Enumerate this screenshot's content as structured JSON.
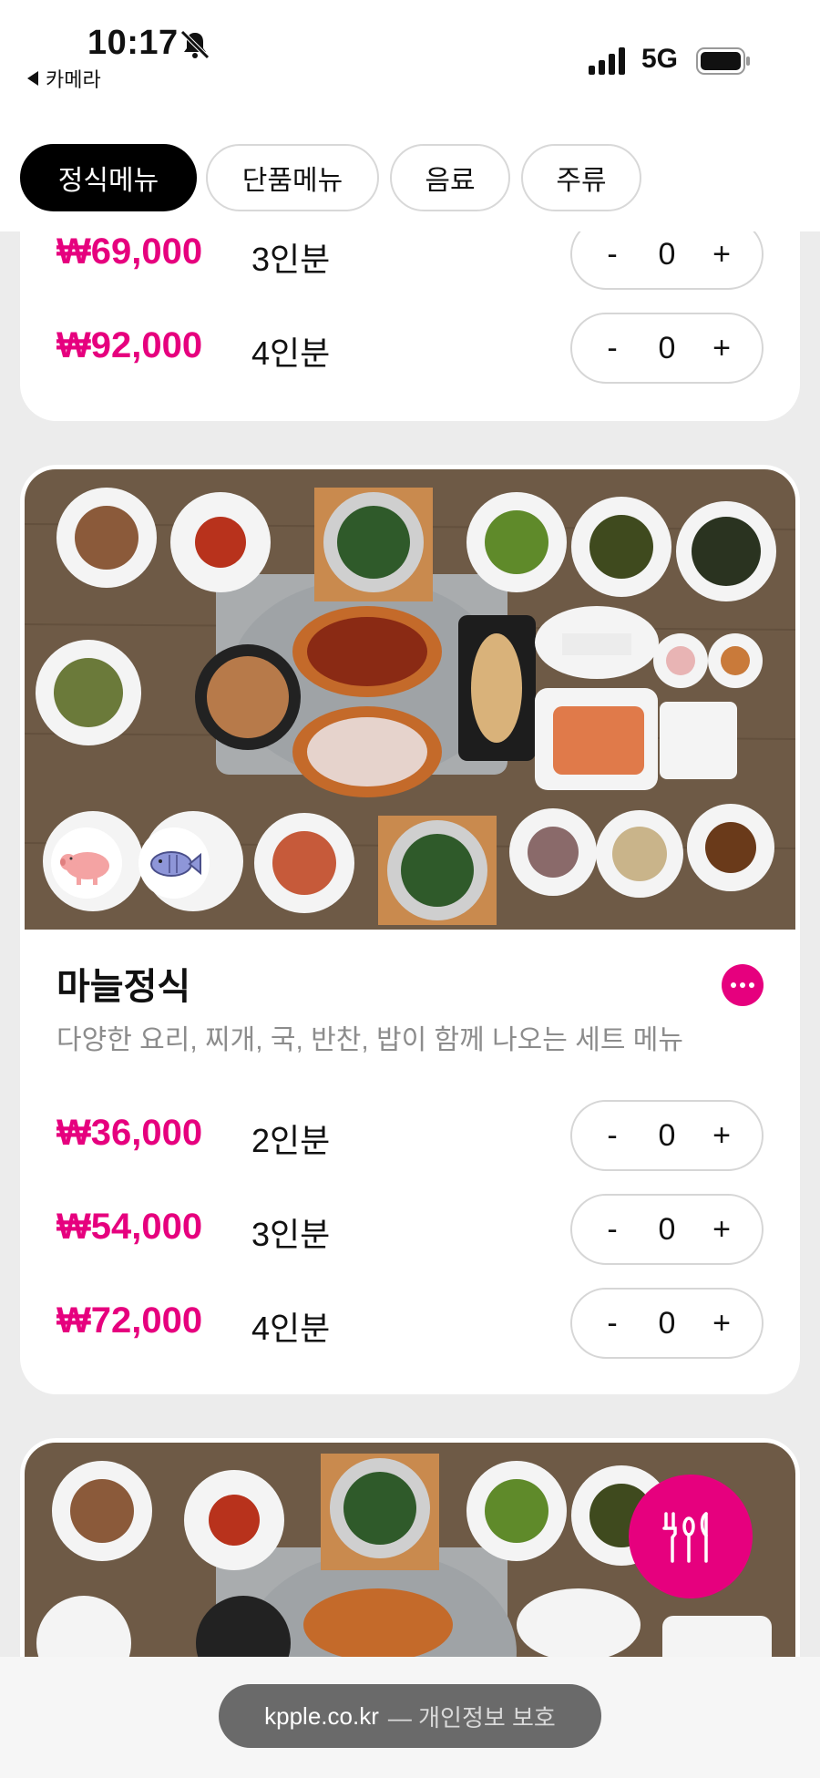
{
  "status_bar": {
    "time": "10:17",
    "back_app": "카메라",
    "network": "5G",
    "icons": [
      "bell-muted-icon",
      "signal-icon",
      "battery-icon"
    ]
  },
  "tabs": [
    {
      "label": "정식메뉴",
      "active": true
    },
    {
      "label": "단품메뉴",
      "active": false
    },
    {
      "label": "음료",
      "active": false
    },
    {
      "label": "주류",
      "active": false
    }
  ],
  "card_top": {
    "rows": [
      {
        "price": "₩69,000",
        "portion": "3인분",
        "qty": "0"
      },
      {
        "price": "₩92,000",
        "portion": "4인분",
        "qty": "0"
      }
    ]
  },
  "card_main": {
    "title": "마늘정식",
    "description": "다양한 요리, 찌개, 국, 반찬, 밥이 함께 나오는 세트 메뉴",
    "badges": [
      "pig-icon",
      "fish-icon"
    ],
    "rows": [
      {
        "price": "₩36,000",
        "portion": "2인분",
        "qty": "0"
      },
      {
        "price": "₩54,000",
        "portion": "3인분",
        "qty": "0"
      },
      {
        "price": "₩72,000",
        "portion": "4인분",
        "qty": "0"
      }
    ]
  },
  "stepper": {
    "minus": "-",
    "plus": "+"
  },
  "fab": {
    "icon": "utensils-icon"
  },
  "browser": {
    "domain": "kpple.co.kr",
    "privacy": "— 개인정보 보호"
  },
  "colors": {
    "accent": "#e6007e",
    "active_tab": "#000000",
    "background": "#ececec"
  }
}
